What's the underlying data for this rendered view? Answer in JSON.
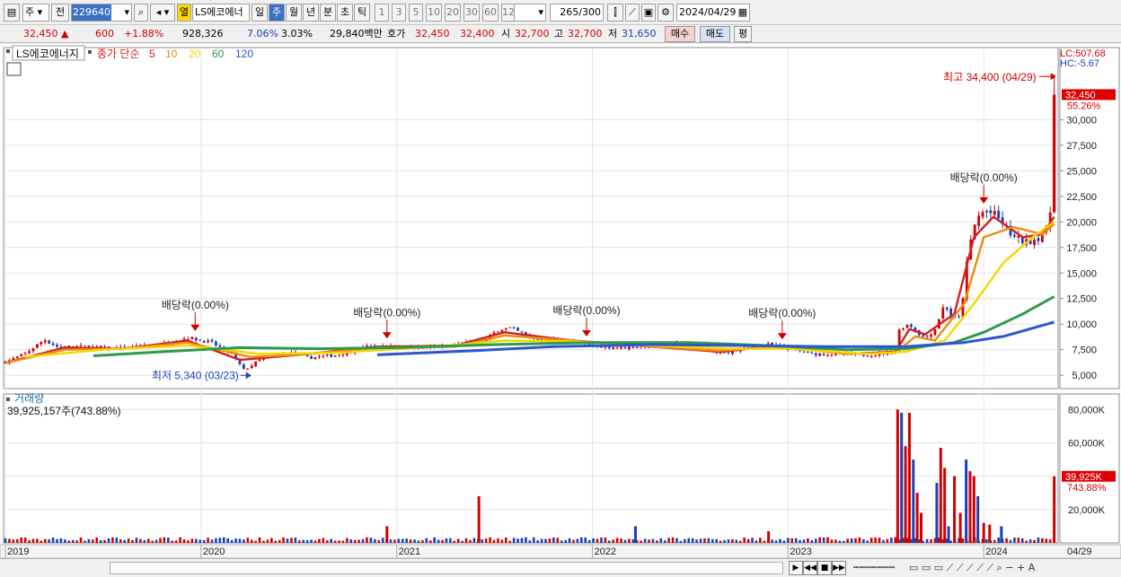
{
  "toolbar": {
    "market": "주",
    "prev_label": "전",
    "code": "229640",
    "stock_name": "LS에코에너",
    "hot_label": "열",
    "periods": [
      "일",
      "주",
      "월",
      "년",
      "분",
      "초",
      "틱"
    ],
    "selected_period": "주",
    "intervals": [
      "1",
      "3",
      "5",
      "10",
      "20",
      "30",
      "60",
      "120"
    ],
    "count": "265",
    "count_total": "/300",
    "date": "2024/04/29"
  },
  "quote": {
    "price": "32,450",
    "change": "600",
    "change_pct": "+1.88%",
    "volume": "928,326",
    "turnover": "7.06%",
    "ratio": "3.03%",
    "amount": "29,840백만",
    "hoga_label": "호가",
    "hoga_ask": "32,450",
    "hoga_bid": "32,400",
    "open_label": "시",
    "open": "32,700",
    "high_label": "고",
    "high": "32,700",
    "low_label": "저",
    "low": "31,650",
    "buy_label": "매수",
    "sell_label": "매도",
    "eval_label": "평"
  },
  "legend": {
    "name": "LS에코에너지",
    "ma_label": "종가 단순",
    "ma_periods": [
      "5",
      "10",
      "20",
      "60",
      "120"
    ],
    "ma_colors": [
      "#d42020",
      "#ee8a10",
      "#f2d800",
      "#2f9a4a",
      "#2c55d4"
    ],
    "lc": "LC:507.68",
    "hc": "HC:-5.67",
    "last_price": "32,450",
    "last_pct": "55.26%",
    "high_note": "최고 34,400 (04/29)",
    "low_note": "최저 5,340 (03/23)",
    "dividend_label": "배당락(0.00%)"
  },
  "volume_panel": {
    "title": "거래량",
    "value": "39,925,157주(743.88%)",
    "last": "39,925K",
    "last_pct": "743.88%"
  },
  "footer": {
    "last_date": "04/29"
  },
  "colors": {
    "up": "#d20000",
    "down": "#1b3fb8",
    "badge": "#e00000",
    "dividend": "#d00000"
  },
  "chart_data": {
    "type": "candlestick",
    "title": "",
    "y_ticks": [
      5000,
      7500,
      10000,
      12500,
      15000,
      17500,
      20000,
      22500,
      25000,
      27500,
      30000
    ],
    "y_tick_labels": [
      "5,000",
      "7,500",
      "10,000",
      "12,500",
      "15,000",
      "17,500",
      "20,000",
      "22,500",
      "25,000",
      "27,500",
      "30,000"
    ],
    "vol_ticks": [
      20000,
      40000,
      60000,
      80000
    ],
    "vol_tick_labels": [
      "20,000K",
      "40,000K",
      "60,000K",
      "80,000K"
    ],
    "vol_ylim": [
      0,
      85000
    ],
    "ylim": [
      3700,
      36000
    ],
    "x_labels": [
      {
        "label": "2019",
        "t": 2019.0
      },
      {
        "label": "2020",
        "t": 2020.0
      },
      {
        "label": "2021",
        "t": 2021.0
      },
      {
        "label": "2022",
        "t": 2022.0
      },
      {
        "label": "2023",
        "t": 2023.0
      },
      {
        "label": "2024",
        "t": 2024.0
      }
    ],
    "x_range": [
      2019.0,
      2024.38
    ],
    "anchors": [
      [
        2019.0,
        6300
      ],
      [
        2019.1,
        7100
      ],
      [
        2019.2,
        8500
      ],
      [
        2019.26,
        7800
      ],
      [
        2019.4,
        7800
      ],
      [
        2019.55,
        7600
      ],
      [
        2019.7,
        7800
      ],
      [
        2019.85,
        8200
      ],
      [
        2019.93,
        8700
      ],
      [
        2020.05,
        8200
      ],
      [
        2020.15,
        7200
      ],
      [
        2020.22,
        5500
      ],
      [
        2020.3,
        6500
      ],
      [
        2020.45,
        7200
      ],
      [
        2020.55,
        6700
      ],
      [
        2020.7,
        7000
      ],
      [
        2020.85,
        7800
      ],
      [
        2021.0,
        7800
      ],
      [
        2021.2,
        7700
      ],
      [
        2021.35,
        8100
      ],
      [
        2021.45,
        8400
      ],
      [
        2021.52,
        9500
      ],
      [
        2021.58,
        9600
      ],
      [
        2021.7,
        8600
      ],
      [
        2021.85,
        8400
      ],
      [
        2022.0,
        7900
      ],
      [
        2022.15,
        7700
      ],
      [
        2022.3,
        7900
      ],
      [
        2022.45,
        8100
      ],
      [
        2022.55,
        7600
      ],
      [
        2022.65,
        7100
      ],
      [
        2022.8,
        7700
      ],
      [
        2022.9,
        8000
      ],
      [
        2023.0,
        7600
      ],
      [
        2023.12,
        7100
      ],
      [
        2023.3,
        7000
      ],
      [
        2023.45,
        7000
      ],
      [
        2023.55,
        7400
      ],
      [
        2023.57,
        9600
      ],
      [
        2023.62,
        10000
      ],
      [
        2023.66,
        9200
      ],
      [
        2023.7,
        8600
      ],
      [
        2023.75,
        9500
      ],
      [
        2023.8,
        12000
      ],
      [
        2023.84,
        10500
      ],
      [
        2023.88,
        10600
      ],
      [
        2023.92,
        17000
      ],
      [
        2023.95,
        19500
      ],
      [
        2023.97,
        20500
      ],
      [
        2024.0,
        21000
      ],
      [
        2024.05,
        20800
      ],
      [
        2024.1,
        19800
      ],
      [
        2024.15,
        18500
      ],
      [
        2024.22,
        18000
      ],
      [
        2024.28,
        18500
      ],
      [
        2024.32,
        19200
      ],
      [
        2024.345,
        21500
      ],
      [
        2024.36,
        32450
      ]
    ],
    "ma": [
      {
        "period": "5",
        "points": [
          [
            2019.0,
            6200
          ],
          [
            2019.3,
            7700
          ],
          [
            2019.6,
            7600
          ],
          [
            2019.93,
            8400
          ],
          [
            2020.2,
            6500
          ],
          [
            2020.5,
            7000
          ],
          [
            2020.9,
            7800
          ],
          [
            2021.3,
            7900
          ],
          [
            2021.55,
            9200
          ],
          [
            2021.9,
            8400
          ],
          [
            2022.3,
            7800
          ],
          [
            2022.65,
            7300
          ],
          [
            2022.95,
            7900
          ],
          [
            2023.3,
            7100
          ],
          [
            2023.55,
            7300
          ],
          [
            2023.62,
            9500
          ],
          [
            2023.7,
            9000
          ],
          [
            2023.85,
            11000
          ],
          [
            2023.95,
            18500
          ],
          [
            2024.05,
            20500
          ],
          [
            2024.2,
            18500
          ],
          [
            2024.3,
            18800
          ],
          [
            2024.36,
            20500
          ]
        ]
      },
      {
        "period": "10",
        "points": [
          [
            2019.0,
            6200
          ],
          [
            2019.3,
            7500
          ],
          [
            2019.6,
            7600
          ],
          [
            2019.93,
            8200
          ],
          [
            2020.25,
            6800
          ],
          [
            2020.5,
            7000
          ],
          [
            2020.9,
            7700
          ],
          [
            2021.3,
            7800
          ],
          [
            2021.55,
            8900
          ],
          [
            2021.9,
            8400
          ],
          [
            2022.3,
            7800
          ],
          [
            2022.65,
            7400
          ],
          [
            2022.95,
            7800
          ],
          [
            2023.3,
            7100
          ],
          [
            2023.55,
            7200
          ],
          [
            2023.65,
            8800
          ],
          [
            2023.75,
            8400
          ],
          [
            2023.9,
            12000
          ],
          [
            2024.0,
            18500
          ],
          [
            2024.15,
            19500
          ],
          [
            2024.3,
            18800
          ],
          [
            2024.36,
            19800
          ]
        ]
      },
      {
        "period": "20",
        "points": [
          [
            2019.1,
            6800
          ],
          [
            2019.5,
            7500
          ],
          [
            2019.93,
            7900
          ],
          [
            2020.3,
            7100
          ],
          [
            2020.7,
            7200
          ],
          [
            2021.2,
            7800
          ],
          [
            2021.55,
            8400
          ],
          [
            2021.9,
            8300
          ],
          [
            2022.3,
            7900
          ],
          [
            2022.7,
            7600
          ],
          [
            2023.0,
            7600
          ],
          [
            2023.4,
            7100
          ],
          [
            2023.6,
            7300
          ],
          [
            2023.8,
            8400
          ],
          [
            2023.95,
            12000
          ],
          [
            2024.1,
            16000
          ],
          [
            2024.25,
            18500
          ],
          [
            2024.36,
            20000
          ]
        ]
      },
      {
        "period": "60",
        "points": [
          [
            2019.45,
            6900
          ],
          [
            2019.8,
            7300
          ],
          [
            2020.2,
            7700
          ],
          [
            2020.6,
            7600
          ],
          [
            2021.0,
            7700
          ],
          [
            2021.5,
            8000
          ],
          [
            2022.0,
            8200
          ],
          [
            2022.5,
            8200
          ],
          [
            2022.9,
            7900
          ],
          [
            2023.3,
            7500
          ],
          [
            2023.6,
            7600
          ],
          [
            2023.85,
            8200
          ],
          [
            2024.0,
            9200
          ],
          [
            2024.2,
            11000
          ],
          [
            2024.36,
            12700
          ]
        ]
      },
      {
        "period": "120",
        "points": [
          [
            2020.9,
            7000
          ],
          [
            2021.4,
            7400
          ],
          [
            2021.8,
            7800
          ],
          [
            2022.3,
            8000
          ],
          [
            2022.8,
            7900
          ],
          [
            2023.2,
            7800
          ],
          [
            2023.6,
            7800
          ],
          [
            2023.9,
            8200
          ],
          [
            2024.1,
            8800
          ],
          [
            2024.36,
            10200
          ]
        ]
      }
    ],
    "dividends": [
      2019.97,
      2020.95,
      2021.97,
      2022.97,
      2024.0
    ],
    "high": {
      "t": 2024.36,
      "value": 34400
    },
    "low": {
      "t": 2020.22,
      "value": 5340
    },
    "volume_spikes": [
      [
        2021.42,
        28000
      ],
      [
        2023.56,
        80000
      ],
      [
        2023.58,
        78000
      ],
      [
        2023.6,
        58000
      ],
      [
        2023.62,
        78000
      ],
      [
        2023.64,
        50000
      ],
      [
        2023.66,
        30000
      ],
      [
        2023.68,
        18000
      ],
      [
        2023.76,
        36000
      ],
      [
        2023.78,
        57000
      ],
      [
        2023.8,
        45000
      ],
      [
        2023.82,
        10000
      ],
      [
        2023.85,
        40000
      ],
      [
        2023.88,
        18000
      ],
      [
        2023.91,
        50000
      ],
      [
        2023.93,
        43000
      ],
      [
        2023.95,
        40000
      ],
      [
        2023.97,
        28000
      ],
      [
        2024.0,
        12000
      ],
      [
        2024.03,
        11000
      ],
      [
        2024.09,
        10000
      ],
      [
        2024.36,
        39925
      ],
      [
        2020.95,
        10000
      ],
      [
        2022.22,
        10000
      ],
      [
        2022.9,
        7000
      ]
    ]
  }
}
